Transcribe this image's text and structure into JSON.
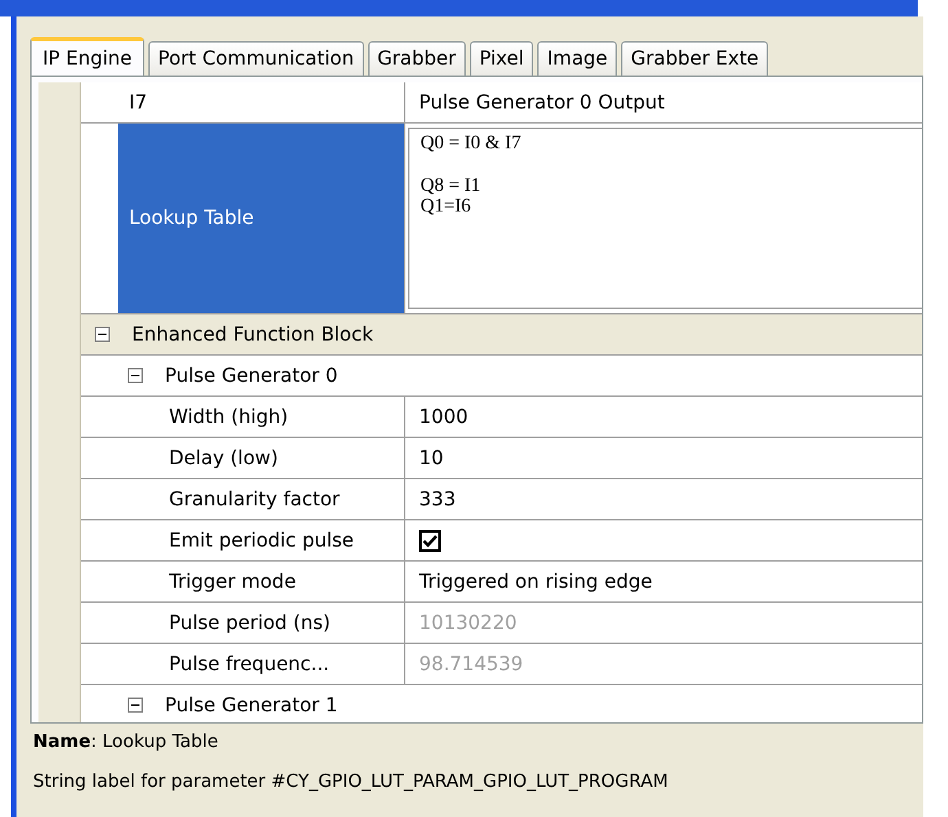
{
  "tabs": [
    {
      "label": "IP Engine",
      "selected": true
    },
    {
      "label": "Port Communication",
      "selected": false
    },
    {
      "label": "Grabber",
      "selected": false
    },
    {
      "label": "Pixel",
      "selected": false
    },
    {
      "label": "Image",
      "selected": false
    },
    {
      "label": "Grabber Exte",
      "selected": false
    }
  ],
  "properties": [
    {
      "kind": "text",
      "name": "I7",
      "value": "Pulse Generator 0 Output",
      "selected": false,
      "disabled": false
    },
    {
      "kind": "multiline",
      "name": "Lookup Table",
      "value": "Q0 = I0 & I7\n\nQ8 = I1\nQ1=I6",
      "selected": true
    },
    {
      "kind": "category",
      "name": "Enhanced Function Block",
      "expanded": true,
      "children": [
        {
          "kind": "category",
          "name": "Pulse Generator 0",
          "expanded": true,
          "children": [
            {
              "kind": "text",
              "name": "Width (high)",
              "value": "1000",
              "selected": false,
              "disabled": false
            },
            {
              "kind": "text",
              "name": "Delay (low)",
              "value": "10",
              "selected": false,
              "disabled": false
            },
            {
              "kind": "text",
              "name": "Granularity factor",
              "value": "333",
              "selected": false,
              "disabled": false
            },
            {
              "kind": "checkbox",
              "name": "Emit periodic pulse",
              "checked": true,
              "selected": false
            },
            {
              "kind": "text",
              "name": "Trigger mode",
              "value": "Triggered on rising edge",
              "selected": false,
              "disabled": false
            },
            {
              "kind": "text",
              "name": "Pulse period (ns)",
              "value": "10130220",
              "selected": false,
              "disabled": true
            },
            {
              "kind": "text",
              "name": "Pulse frequenc...",
              "value": "98.714539",
              "selected": false,
              "disabled": true
            }
          ]
        },
        {
          "kind": "category",
          "name": "Pulse Generator 1",
          "expanded": true
        }
      ]
    }
  ],
  "description": {
    "title": "**Name**: Lookup Table",
    "text": "String label for parameter #CY_GPIO_LUT_PARAM_GPIO_LUT_PROGRAM"
  }
}
